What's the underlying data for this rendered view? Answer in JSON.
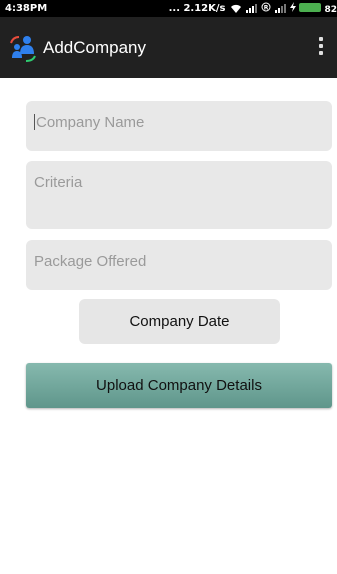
{
  "status_bar": {
    "time": "4:38PM",
    "speed": "... 2.12K/s",
    "battery": "82"
  },
  "app_bar": {
    "title": "AddCompany"
  },
  "form": {
    "company_name_placeholder": "Company Name",
    "criteria_placeholder": "Criteria",
    "package_placeholder": "Package Offered",
    "date_button_label": "Company Date",
    "upload_button_label": "Upload Company Details"
  },
  "colors": {
    "app_bar": "#212121",
    "field_bg": "#e8e8e8",
    "upload_button": "#6fa79b"
  }
}
